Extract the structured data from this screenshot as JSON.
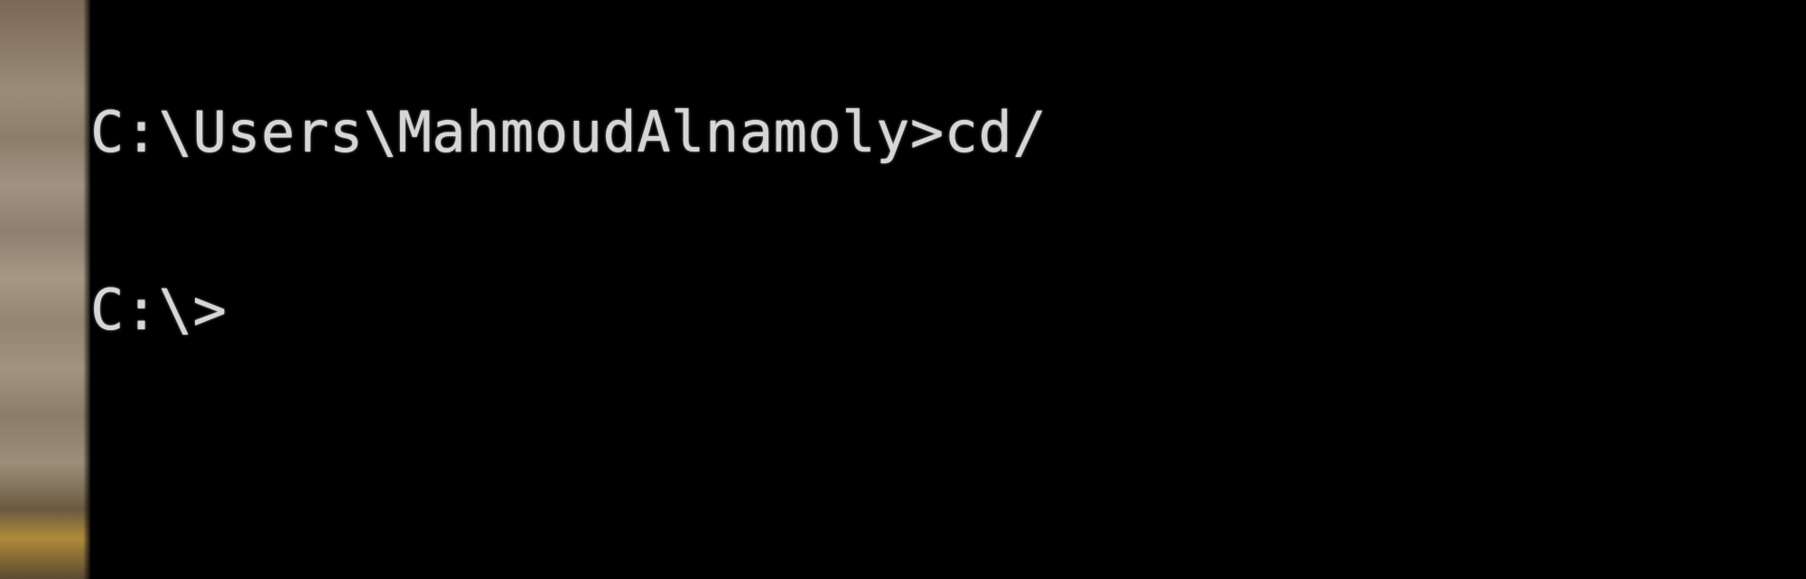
{
  "terminal": {
    "lines": [
      {
        "text": "C:\\Users\\MahmoudAlnamoly>cd/"
      },
      {
        "text": "C:\\>"
      }
    ]
  }
}
